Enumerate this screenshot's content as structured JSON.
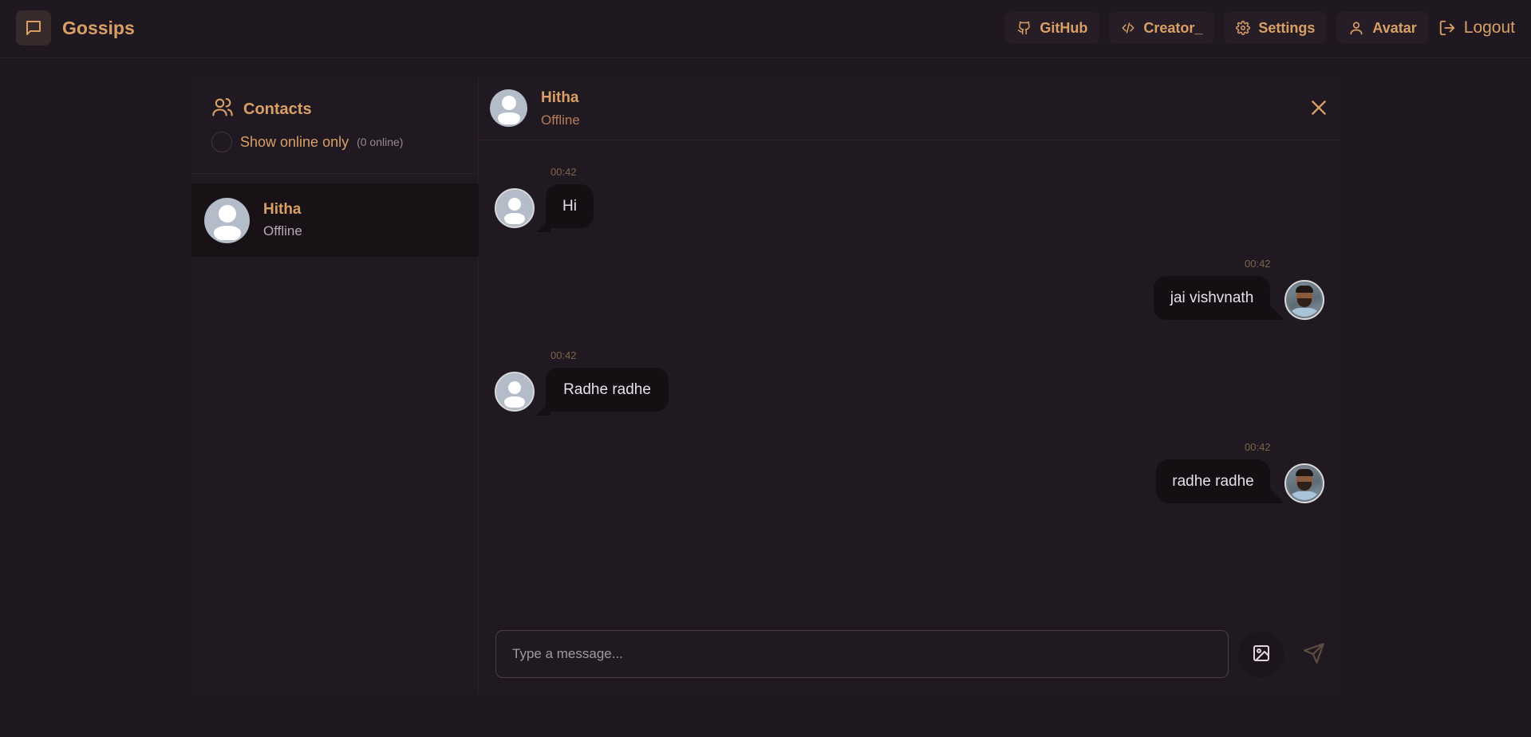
{
  "brand": {
    "name": "Gossips",
    "icon": "chat-bubble-icon"
  },
  "nav": {
    "github": "GitHub",
    "creator": "Creator_",
    "settings": "Settings",
    "avatar": "Avatar",
    "logout": "Logout"
  },
  "sidebar": {
    "title": "Contacts",
    "show_online_label": "Show online only",
    "online_count": "(0 online)",
    "contacts": [
      {
        "name": "Hitha",
        "status": "Offline"
      }
    ]
  },
  "chat": {
    "name": "Hitha",
    "status": "Offline",
    "messages": [
      {
        "time": "00:42",
        "text": "Hi",
        "direction": "incoming"
      },
      {
        "time": "00:42",
        "text": "jai vishvnath",
        "direction": "outgoing"
      },
      {
        "time": "00:42",
        "text": "Radhe radhe",
        "direction": "incoming"
      },
      {
        "time": "00:42",
        "text": "radhe radhe",
        "direction": "outgoing"
      }
    ]
  },
  "composer": {
    "placeholder": "Type a message..."
  },
  "colors": {
    "background": "#201820",
    "accent": "#d9a066",
    "bubble": "#130f13"
  }
}
